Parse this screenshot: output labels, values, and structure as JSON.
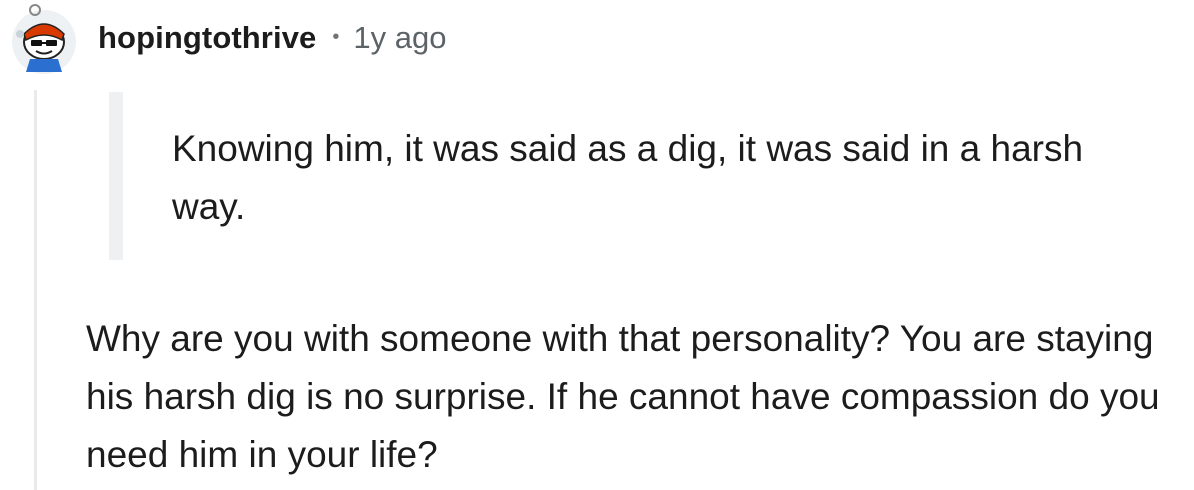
{
  "comment": {
    "username": "hopingtothrive",
    "separator": "•",
    "timestamp": "1y ago",
    "avatar_icon": "snoo-avatar-icon",
    "quote": "Knowing him, it was said as a dig, it was said in a harsh way.",
    "body": "Why are you with someone with that personality? You are staying his harsh dig is no surprise. If he cannot have compassion do you need him in your life?"
  },
  "colors": {
    "text": "#1c1c1c",
    "meta": "#5c6367",
    "thread_line": "#e8eaeb",
    "quote_bar": "#eef0f1",
    "avatar_accent": "#d93a00"
  }
}
